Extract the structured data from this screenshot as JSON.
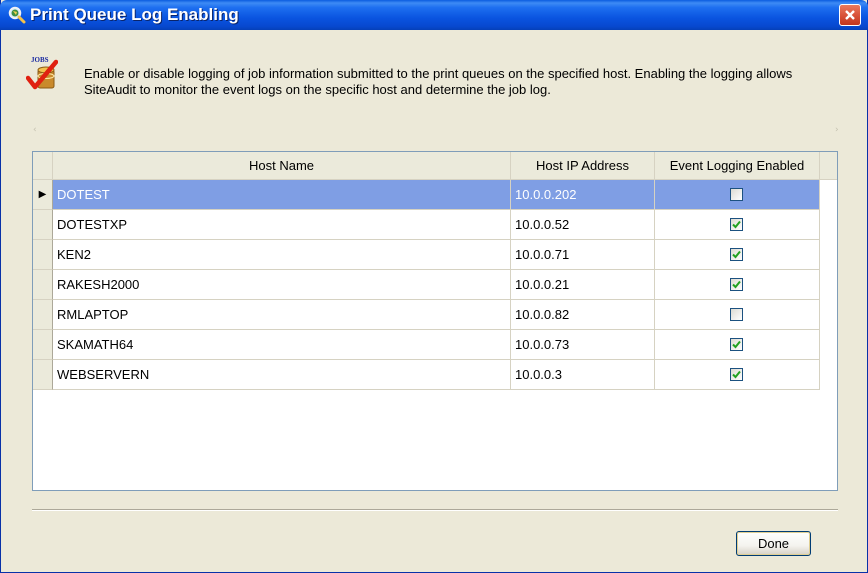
{
  "window": {
    "title": "Print Queue Log Enabling",
    "icon": "magnifier-globe-icon",
    "close_icon": "close-icon"
  },
  "header": {
    "icon": "jobs-check-icon",
    "icon_text": "JOBS",
    "description": "Enable or disable logging of job information submitted to the print queues on the specified host.  Enabling the logging allows SiteAudit to monitor the event logs on the specific host and determine the job log."
  },
  "grid": {
    "columns": [
      "Host Name",
      "Host IP Address",
      "Event Logging Enabled"
    ],
    "rows": [
      {
        "host": "DOTEST",
        "ip": "10.0.0.202",
        "enabled": false,
        "selected": true
      },
      {
        "host": "DOTESTXP",
        "ip": "10.0.0.52",
        "enabled": true,
        "selected": false
      },
      {
        "host": "KEN2",
        "ip": "10.0.0.71",
        "enabled": true,
        "selected": false
      },
      {
        "host": "RAKESH2000",
        "ip": "10.0.0.21",
        "enabled": true,
        "selected": false
      },
      {
        "host": "RMLAPTOP",
        "ip": "10.0.0.82",
        "enabled": false,
        "selected": false
      },
      {
        "host": "SKAMATH64",
        "ip": "10.0.0.73",
        "enabled": true,
        "selected": false
      },
      {
        "host": "WEBSERVERN",
        "ip": "10.0.0.3",
        "enabled": true,
        "selected": false
      }
    ],
    "current_row_icon": "row-pointer-icon"
  },
  "footer": {
    "done_label": "Done"
  },
  "colors": {
    "titlebar": "#0a54e0",
    "selection": "#7f9ee4",
    "window_bg": "#ece9d8",
    "check": "#21a121"
  }
}
